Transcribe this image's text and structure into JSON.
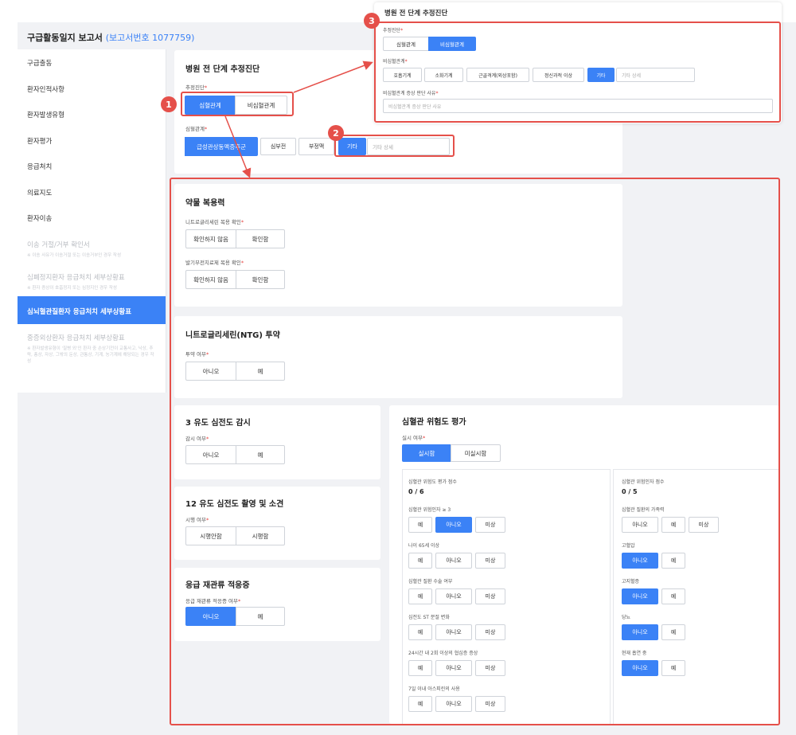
{
  "header": {
    "title": "구급활동일지 보고서",
    "report_no": "(보고서번호 1077759)"
  },
  "sidebar": {
    "items": [
      {
        "label": "구급출동"
      },
      {
        "label": "환자인적사항"
      },
      {
        "label": "환자발생유형"
      },
      {
        "label": "환자평가"
      },
      {
        "label": "응급처치"
      },
      {
        "label": "의료지도"
      },
      {
        "label": "환자이송"
      }
    ],
    "disabled": [
      {
        "label": "이송 거절/거부 확인서",
        "sub": "※ 이송 사유가 이송거절 또는 이송거부인 경우 작성"
      },
      {
        "label": "심폐정지환자 응급처치 세부상황표",
        "sub": "※ 환자 증상이 호흡정지 또는 심정지인 경우 작성"
      }
    ],
    "active": "심뇌혈관질환자 응급처치 세부상황표",
    "last": {
      "label": "중증외상환자 응급처치 세부상황표",
      "sub": "※ 환자발생유형이 '질병 외'인 환자 중 손상기전이 교통사고, 낙상, 추락, 총상, 자상, 그밖의 둔상, 관통상, 기계, 농기계에 해당되는 경우 작성"
    }
  },
  "prehospital": {
    "title": "병원 전 단계 추정진단",
    "diag_label": "추정진단",
    "diag_opts": [
      "심혈관계",
      "비심혈관계"
    ],
    "cardio_label": "심혈관계",
    "cardio_opts": [
      "급성관상동맥증후군",
      "심부전",
      "부정맥",
      "기타"
    ],
    "other_placeholder": "기타 상세"
  },
  "popup": {
    "title": "병원 전 단계 추정진단",
    "diag_label": "추정진단",
    "diag_opts": [
      "심혈관계",
      "비심혈관계"
    ],
    "noncardio_label": "비심혈관계",
    "noncardio_opts": [
      "호흡기계",
      "소화기계",
      "근골격계(외상포함)",
      "정신과적 이상",
      "기타"
    ],
    "other_placeholder": "기타 상세",
    "reason_label": "비심혈관계 증상 판단 사유",
    "reason_placeholder": "비심혈관계 증상 판단 사유"
  },
  "badges": [
    "1",
    "2",
    "3"
  ],
  "meds": {
    "title": "약물 복용력",
    "nitro_label": "니트로글리세린 복용 확인",
    "nitro_opts": [
      "확인하지 않음",
      "확인함"
    ],
    "pde_label": "발기부전치료제 복용 확인",
    "pde_opts": [
      "확인하지 않음",
      "확인함"
    ]
  },
  "ntg": {
    "title": "니트로글리세린(NTG) 투약",
    "label": "투약 여부",
    "opts": [
      "아니오",
      "예"
    ]
  },
  "ecg3": {
    "title": "3 유도 심전도 감시",
    "label": "감시 여부",
    "opts": [
      "아니오",
      "예"
    ]
  },
  "ecg12": {
    "title": "12 유도 심전도 촬영 및 소견",
    "label": "시행 여부",
    "opts": [
      "시행안함",
      "시행함"
    ]
  },
  "reperf": {
    "title": "응급 재관류 적응증",
    "label": "응급 재관류 적응증 여부",
    "opts": [
      "아니오",
      "예"
    ]
  },
  "risk": {
    "title": "심혈관 위험도 평가",
    "label": "실시 여부",
    "opts": [
      "실시함",
      "미실시함"
    ],
    "left_score_label": "심혈관 위험도 평가 점수",
    "left_score": "0 / 6",
    "left_items": [
      {
        "label": "심혈관 위험인자 ≥ 3",
        "opts": [
          "예",
          "아니오",
          "미상"
        ],
        "sel": 1
      },
      {
        "label": "나이 65세 이상",
        "opts": [
          "예",
          "아니오",
          "미상"
        ],
        "sel": -1
      },
      {
        "label": "심혈관 질환 수술 여부",
        "opts": [
          "예",
          "아니오",
          "미상"
        ],
        "sel": -1
      },
      {
        "label": "심전도 ST 분절 변화",
        "opts": [
          "예",
          "아니오",
          "미상"
        ],
        "sel": -1
      },
      {
        "label": "24시간 내 2회 이상의 협심증 증상",
        "opts": [
          "예",
          "아니오",
          "미상"
        ],
        "sel": -1
      },
      {
        "label": "7일 이내 아스피린의 사용",
        "opts": [
          "예",
          "아니오",
          "미상"
        ],
        "sel": -1
      }
    ],
    "right_score_label": "심혈관 위험인자 점수",
    "right_score": "0 / 5",
    "right_items": [
      {
        "label": "심혈관 질환의 가족력",
        "opts": [
          "아니오",
          "예",
          "미상"
        ],
        "sel": -1
      },
      {
        "label": "고혈압",
        "opts": [
          "아니오",
          "예"
        ],
        "sel": 0
      },
      {
        "label": "고지혈증",
        "opts": [
          "아니오",
          "예"
        ],
        "sel": 0
      },
      {
        "label": "당뇨",
        "opts": [
          "아니오",
          "예"
        ],
        "sel": 0
      },
      {
        "label": "현재 흡연 중",
        "opts": [
          "아니오",
          "예"
        ],
        "sel": 0
      }
    ]
  }
}
